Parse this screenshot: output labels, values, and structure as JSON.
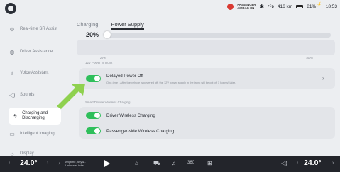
{
  "status": {
    "airbag_line1": "PASSENGER",
    "airbag_line2": "AIRBAG ON",
    "signal": "⁴ᴳᴅ",
    "range": "416 km",
    "battery": "81%",
    "time": "18:53"
  },
  "sidebar": {
    "items": [
      {
        "label": "Real-time SR Assist",
        "icon": "steering-icon"
      },
      {
        "label": "Driver Assistance",
        "icon": "driver-assist-icon"
      },
      {
        "label": "Voice Assistant",
        "icon": "voice-icon"
      },
      {
        "label": "Sounds",
        "icon": "speaker-icon"
      },
      {
        "label": "Charging and Discharging",
        "icon": "charging-icon"
      },
      {
        "label": "Intelligent Imaging",
        "icon": "camera-icon"
      },
      {
        "label": "Display",
        "icon": "sun-icon"
      }
    ]
  },
  "tabs": {
    "charging": "Charging",
    "power_supply": "Power Supply"
  },
  "slider": {
    "value": "20%",
    "min_label": "20%",
    "max_label": "100%",
    "level": 0.0
  },
  "sections": {
    "power_in_trunk": "12V Power in Trunk",
    "wireless": "Smart Device Wireless Charging"
  },
  "delayed_power": {
    "title": "Delayed Power Off",
    "desc": "One-time - After the vehicle is powered off, the 12V power supply in the trunk will be cut off 1 hour(s) later.",
    "enabled": true
  },
  "driver_wireless": {
    "title": "Driver Wireless Charging",
    "enabled": true
  },
  "passenger_wireless": {
    "title": "Passenger-side Wireless Charging",
    "enabled": true
  },
  "dock": {
    "left_temp": "24.0°",
    "right_temp": "24.0°",
    "media_line1": "Anytime, Anyw...",
    "media_line2": "Unknown Artist",
    "icons": [
      "home-icon",
      "car-icon",
      "music-icon",
      "360-icon",
      "apps-icon",
      "volume-icon"
    ]
  },
  "colors": {
    "toggle_on": "#2fbf5b",
    "arrow": "#8fd14f"
  }
}
